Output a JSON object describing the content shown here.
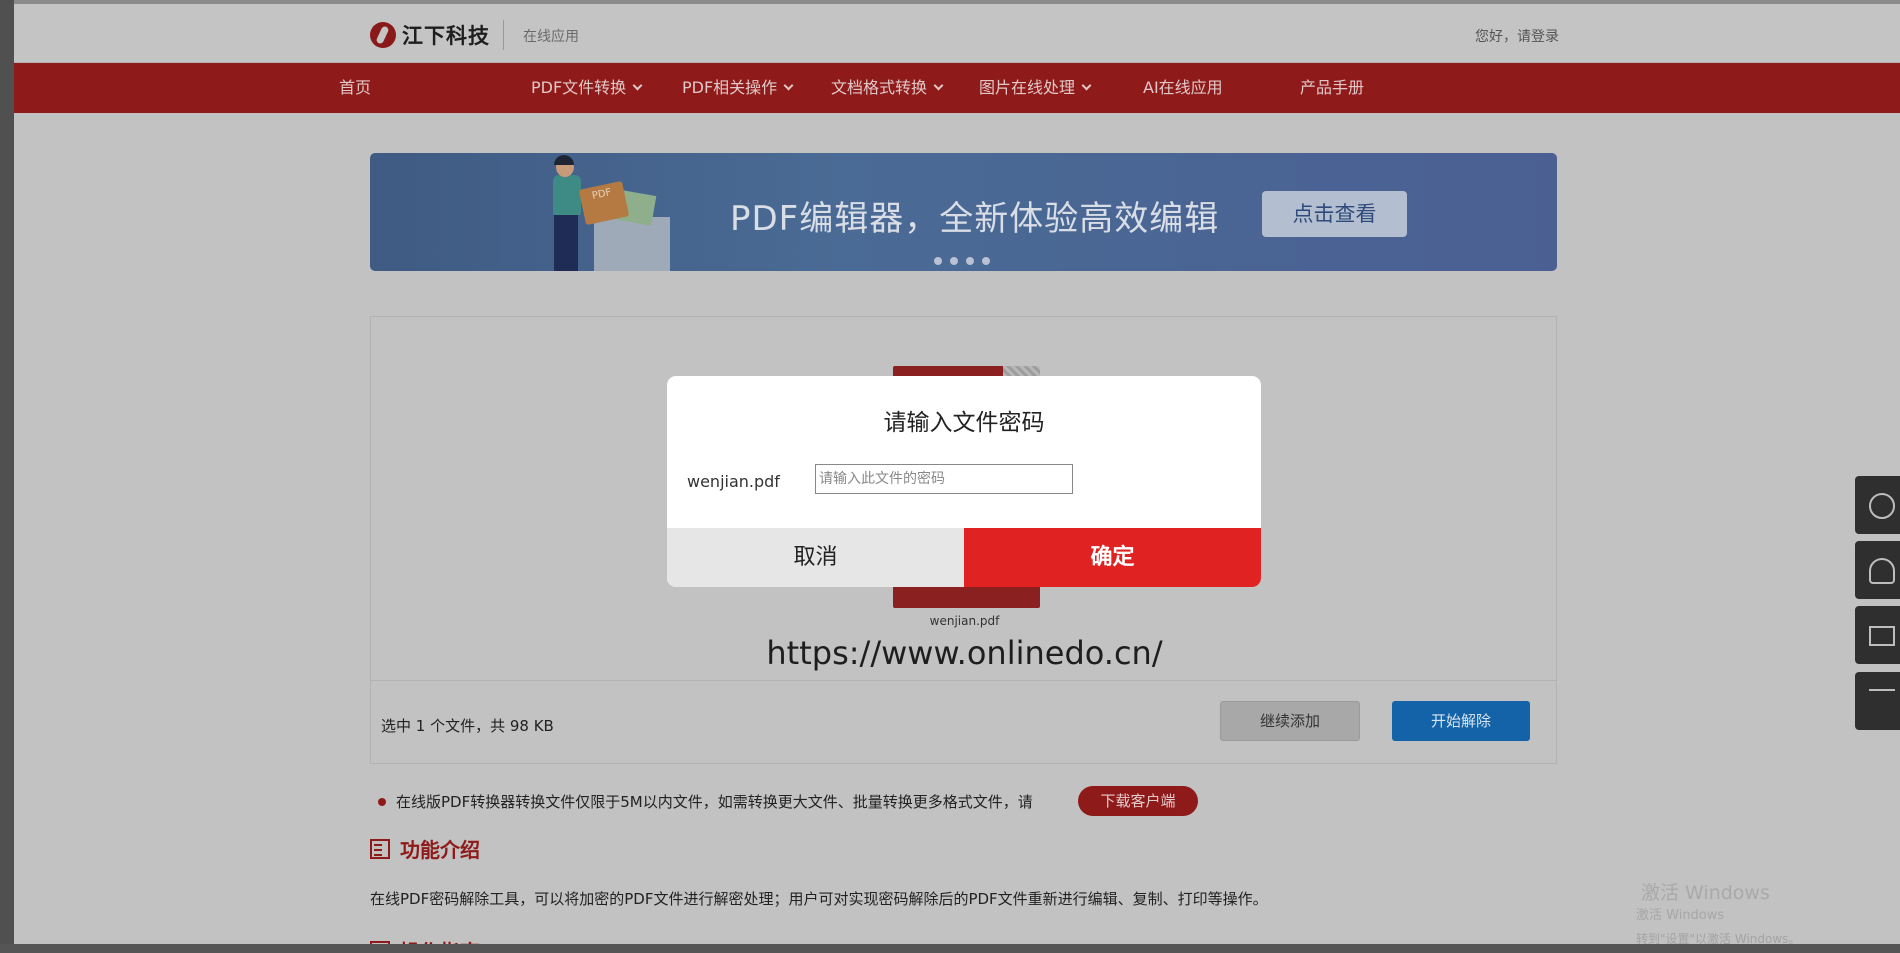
{
  "header": {
    "brand": "江下科技",
    "subtitle": "在线应用",
    "login": "您好，请登录"
  },
  "nav": {
    "items": [
      {
        "label": "首页",
        "dropdown": false
      },
      {
        "label": "PDF文件转换",
        "dropdown": true
      },
      {
        "label": "PDF相关操作",
        "dropdown": true
      },
      {
        "label": "文档格式转换",
        "dropdown": true
      },
      {
        "label": "图片在线处理",
        "dropdown": true
      },
      {
        "label": "AI在线应用",
        "dropdown": false
      },
      {
        "label": "产品手册",
        "dropdown": false
      }
    ]
  },
  "banner": {
    "headline": "PDF编辑器，全新体验高效编辑",
    "button_label": "点击查看",
    "folder_label": "PDF",
    "slides": 4
  },
  "upload": {
    "file_name": "wenjian.pdf",
    "url": "https://www.onlinedo.cn/",
    "selected_info": "选中 1 个文件，共 98 KB",
    "add_more_label": "继续添加",
    "start_label": "开始解除"
  },
  "notice": {
    "text": "在线版PDF转换器转换文件仅限于5M以内文件，如需转换更大文件、批量转换更多格式文件，请",
    "download_label": "下载客户端"
  },
  "features": {
    "title": "功能介绍",
    "description": "在线PDF密码解除工具，可以将加密的PDF文件进行解密处理；用户可对实现密码解除后的PDF文件重新进行编辑、复制、打印等操作。",
    "next_title": "操作指南"
  },
  "side_widgets": [
    "phone-icon",
    "headset-icon",
    "mail-icon",
    "back-to-top-icon"
  ],
  "watermark": {
    "line1": "激活 Windows",
    "line2": "激活 Windows",
    "line3": "转到\"设置\"以激活 Windows。"
  },
  "modal": {
    "title": "请输入文件密码",
    "file_name": "wenjian.pdf",
    "password_placeholder": "请输入此文件的密码",
    "password_value": "",
    "cancel_label": "取消",
    "confirm_label": "确定"
  },
  "colors": {
    "brand_red": "#e02222",
    "nav_red_dimmed": "#8f1a1a",
    "primary_blue_dimmed": "#1463a8"
  }
}
